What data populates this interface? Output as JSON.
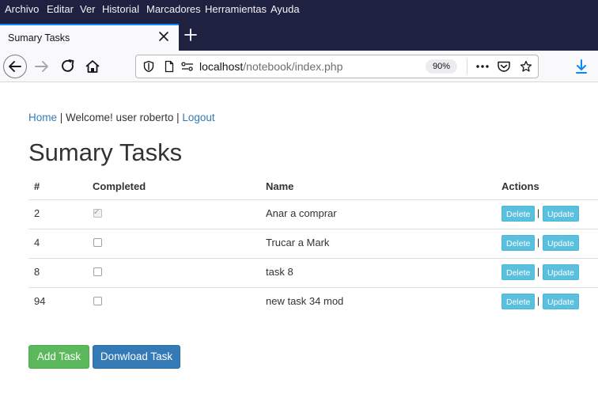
{
  "menu": [
    "Archivo",
    "Editar",
    "Ver",
    "Historial",
    "Marcadores",
    "Herramientas",
    "Ayuda"
  ],
  "tab": {
    "title": "Sumary Tasks"
  },
  "urlbar": {
    "host": "localhost",
    "path": "/notebook/index.php",
    "zoom": "90%"
  },
  "nav": {
    "home_link": "Home",
    "welcome": "| Welcome! user roberto |",
    "logout_link": "Logout"
  },
  "page_title": "Sumary Tasks",
  "table": {
    "headers": [
      "#",
      "Completed",
      "Name",
      "Actions"
    ],
    "rows": [
      {
        "id": "2",
        "completed": true,
        "name": "Anar a comprar"
      },
      {
        "id": "4",
        "completed": false,
        "name": "Trucar a Mark"
      },
      {
        "id": "8",
        "completed": false,
        "name": "task 8"
      },
      {
        "id": "94",
        "completed": false,
        "name": "new task 34 mod"
      }
    ],
    "delete_label": "Delete",
    "separator": "|",
    "update_label": "Update"
  },
  "buttons": {
    "add": "Add Task",
    "download": "Donwload Task"
  },
  "colors": {
    "link": "#337ab7",
    "info": "#5bc0de",
    "success": "#5cb85c",
    "primary": "#337ab7",
    "chrome_dark": "#1f2140",
    "tab_accent": "#0a84ff"
  },
  "icons": [
    "back-arrow-icon",
    "forward-arrow-icon",
    "reload-icon",
    "home-icon",
    "shield-icon",
    "page-icon",
    "permissions-icon",
    "more-icon",
    "pocket-icon",
    "star-icon",
    "download-icon",
    "close-icon",
    "plus-icon"
  ]
}
